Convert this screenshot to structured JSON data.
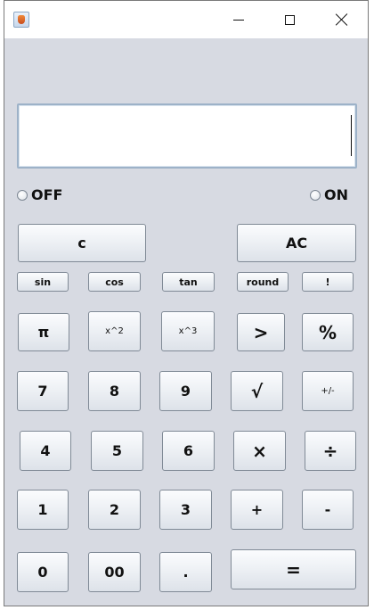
{
  "window": {
    "app_icon": "java-cup-icon"
  },
  "display": {
    "value": ""
  },
  "mode": {
    "off_label": "OFF",
    "on_label": "ON"
  },
  "buttons": {
    "clear": "c",
    "all_clear": "AC",
    "sin": "sin",
    "cos": "cos",
    "tan": "tan",
    "round": "round",
    "factorial": "!",
    "pi": "π",
    "square": "x^2",
    "cube": "x^3",
    "greater": ">",
    "percent": "%",
    "seven": "7",
    "eight": "8",
    "nine": "9",
    "sqrt": "√",
    "plus_minus": "+/-",
    "four": "4",
    "five": "5",
    "six": "6",
    "multiply": "×",
    "divide": "÷",
    "one": "1",
    "two": "2",
    "three": "3",
    "plus": "+",
    "minus": "-",
    "zero": "0",
    "double_zero": "00",
    "decimal": ".",
    "equals": "="
  }
}
